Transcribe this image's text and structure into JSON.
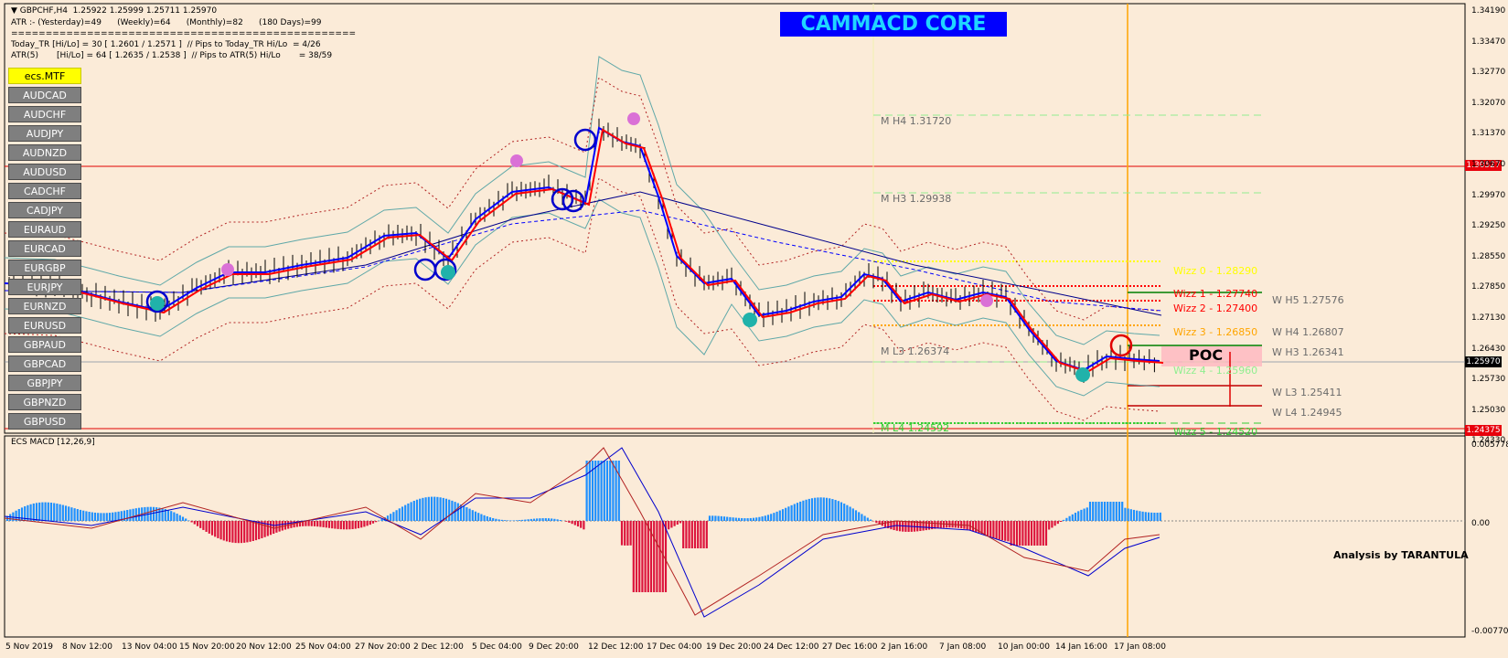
{
  "header": {
    "symbol_line": "▼ GBPCHF,H4  1.25922 1.25999 1.25711 1.25970",
    "atr_line": "ATR :- (Yesterday)=49      (Weekly)=64      (Monthly)=82      (180 Days)=99",
    "separator": "==================================================",
    "today_tr": "Today_TR [Hi/Lo] = 30 [ 1.2601 / 1.2571 ]  // Pips to Today_TR Hi/Lo  = 4/26",
    "atr5": "ATR(5)       [Hi/Lo] = 64 [ 1.2635 / 1.2538 ]  // Pips to ATR(5) Hi/Lo       = 38/59"
  },
  "banner": "CAMMACD CORE",
  "symbols": [
    "ecs.MTF",
    "AUDCAD",
    "AUDCHF",
    "AUDJPY",
    "AUDNZD",
    "AUDUSD",
    "CADCHF",
    "CADJPY",
    "EURAUD",
    "EURCAD",
    "EURGBP",
    "EURJPY",
    "EURNZD",
    "EURUSD",
    "GBPAUD",
    "GBPCAD",
    "GBPJPY",
    "GBPNZD",
    "GBPUSD"
  ],
  "price_axis": [
    "1.34190",
    "1.33470",
    "1.32770",
    "1.32070",
    "1.31370",
    "1.30670",
    "1.29970",
    "1.29250",
    "1.28550",
    "1.27850",
    "1.27130",
    "1.26430",
    "1.25730",
    "1.25030",
    "1.24330"
  ],
  "price_tags": {
    "red_top": "1.30527",
    "current": "1.25970",
    "red_bottom": "1.24375"
  },
  "monthly_levels": [
    "M  H4 1.31720",
    "M  H3 1.29938",
    "M  L3 1.26374",
    "M  L4 1.24592"
  ],
  "weekly_levels": [
    "W  H5 1.27576",
    "W  H4 1.26807",
    "W  H3 1.26341",
    "W  L3 1.25411",
    "W  L4 1.24945"
  ],
  "wizz_levels": [
    {
      "label": "Wizz 0 - 1.28290",
      "color": "#ffff00"
    },
    {
      "label": "Wizz 1 - 1.27740",
      "color": "#ff0000"
    },
    {
      "label": "Wizz 2 - 1.27400",
      "color": "#ff0000"
    },
    {
      "label": "Wizz 3 - 1.26850",
      "color": "#ffa500"
    },
    {
      "label": "Wizz 4 - 1.25960",
      "color": "#90ee90"
    },
    {
      "label": "Wizz 5 - 1.24520",
      "color": "#32cd32"
    }
  ],
  "poc": "POC",
  "macd": {
    "title": "ECS MACD [12,26,9]",
    "axis_top": "0.0057783",
    "axis_zero": "0.00",
    "axis_bottom": "-0.0077016",
    "credit": "Analysis by TARANTULA"
  },
  "time_axis": [
    "5 Nov 2019",
    "8 Nov 12:00",
    "13 Nov 04:00",
    "15 Nov 20:00",
    "20 Nov 12:00",
    "25 Nov 04:00",
    "27 Nov 20:00",
    "2 Dec 12:00",
    "5 Dec 04:00",
    "9 Dec 20:00",
    "12 Dec 12:00",
    "17 Dec 04:00",
    "19 Dec 20:00",
    "24 Dec 12:00",
    "27 Dec 16:00",
    "2 Jan 16:00",
    "7 Jan 08:00",
    "10 Jan 00:00",
    "14 Jan 16:00",
    "17 Jan 08:00"
  ],
  "chart_data": {
    "type": "line",
    "ylim": [
      1.2433,
      1.3419
    ],
    "x": [
      "5 Nov 2019",
      "8 Nov 12:00",
      "13 Nov 04:00",
      "15 Nov 20:00",
      "20 Nov 12:00",
      "25 Nov 04:00",
      "27 Nov 20:00",
      "2 Dec 12:00",
      "5 Dec 04:00",
      "9 Dec 20:00",
      "12 Dec 12:00",
      "17 Dec 04:00",
      "19 Dec 20:00",
      "24 Dec 12:00",
      "27 Dec 16:00",
      "2 Jan 16:00",
      "7 Jan 08:00",
      "10 Jan 00:00",
      "14 Jan 16:00",
      "17 Jan 08:00"
    ],
    "series": [
      {
        "name": "GBPCHF",
        "values": [
          1.278,
          1.277,
          1.274,
          1.2775,
          1.279,
          1.283,
          1.289,
          1.283,
          1.299,
          1.295,
          1.311,
          1.288,
          1.276,
          1.275,
          1.277,
          1.276,
          1.273,
          1.267,
          1.259,
          1.2597
        ]
      }
    ]
  }
}
